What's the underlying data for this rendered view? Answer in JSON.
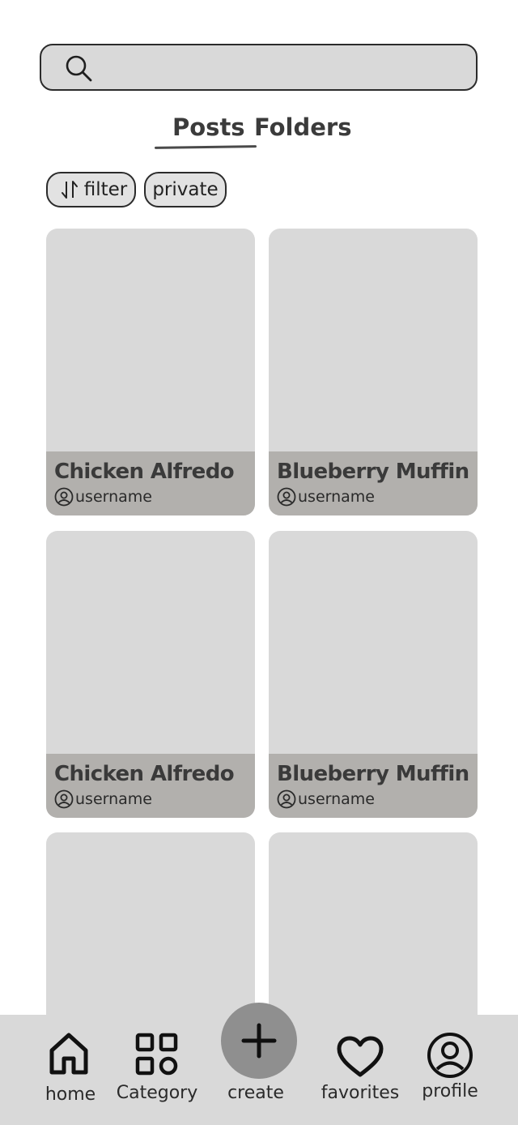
{
  "search": {
    "placeholder": "",
    "value": "",
    "icon": "search-icon"
  },
  "tabs": [
    {
      "label": "Posts",
      "active": true
    },
    {
      "label": "Folders",
      "active": false
    }
  ],
  "chips": {
    "filter": {
      "label": "filter",
      "icon": "sort-arrows-icon"
    },
    "private": {
      "label": "private"
    }
  },
  "posts": [
    {
      "title": "Chicken Alfredo",
      "author": "username"
    },
    {
      "title": "Blueberry Muffin",
      "author": "username"
    },
    {
      "title": "Chicken Alfredo",
      "author": "username"
    },
    {
      "title": "Blueberry Muffin",
      "author": "username"
    }
  ],
  "nav": {
    "home": {
      "label": "home",
      "icon": "home-icon"
    },
    "category": {
      "label": "Category",
      "icon": "grid-icon"
    },
    "create": {
      "label": "create",
      "icon": "plus-icon"
    },
    "favorites": {
      "label": "favorites",
      "icon": "heart-icon"
    },
    "profile": {
      "label": "profile",
      "icon": "user-circle-icon"
    }
  },
  "colors": {
    "background": "#ffffff",
    "surface": "#d9d9d9",
    "card_meta": "#b2b0ad",
    "fab": "#8f8f8f",
    "text": "#2a2a2a"
  }
}
